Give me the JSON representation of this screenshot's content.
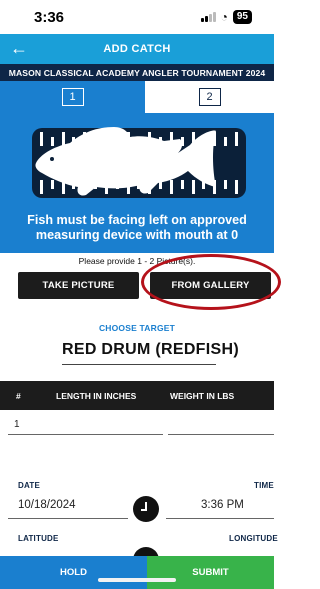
{
  "status": {
    "time": "3:36",
    "battery": "95"
  },
  "header": {
    "back_icon": "arrow-left-icon",
    "title": "ADD CATCH"
  },
  "tournament": "MASON CLASSICAL ACADEMY ANGLER TOURNAMENT 2024",
  "steps": [
    {
      "label": "1",
      "active": false
    },
    {
      "label": "2",
      "active": true
    }
  ],
  "instruction": "Fish must be facing left on approved measuring device with mouth at 0",
  "provide_text": "Please provide 1 - 2 Picture(s).",
  "buttons": {
    "take_picture": "TAKE PICTURE",
    "from_gallery": "FROM GALLERY"
  },
  "choose_target": {
    "label": "CHOOSE TARGET",
    "value": "RED DRUM (REDFISH)"
  },
  "table": {
    "headers": [
      "#",
      "LENGTH IN INCHES",
      "WEIGHT IN LBS"
    ],
    "rows": [
      {
        "num": "1",
        "length": "",
        "weight": ""
      }
    ]
  },
  "date": {
    "label": "DATE",
    "value": "10/18/2024"
  },
  "time": {
    "label": "TIME",
    "value": "3:36 PM"
  },
  "latitude": {
    "label": "LATITUDE"
  },
  "longitude": {
    "label": "LONGITUDE"
  },
  "bottom": {
    "hold": "HOLD",
    "submit": "SUBMIT"
  },
  "colors": {
    "header": "#1a9fd8",
    "navy": "#0e2647",
    "blue": "#1a7fcf",
    "green": "#38b34a",
    "highlight": "#b5121b"
  }
}
